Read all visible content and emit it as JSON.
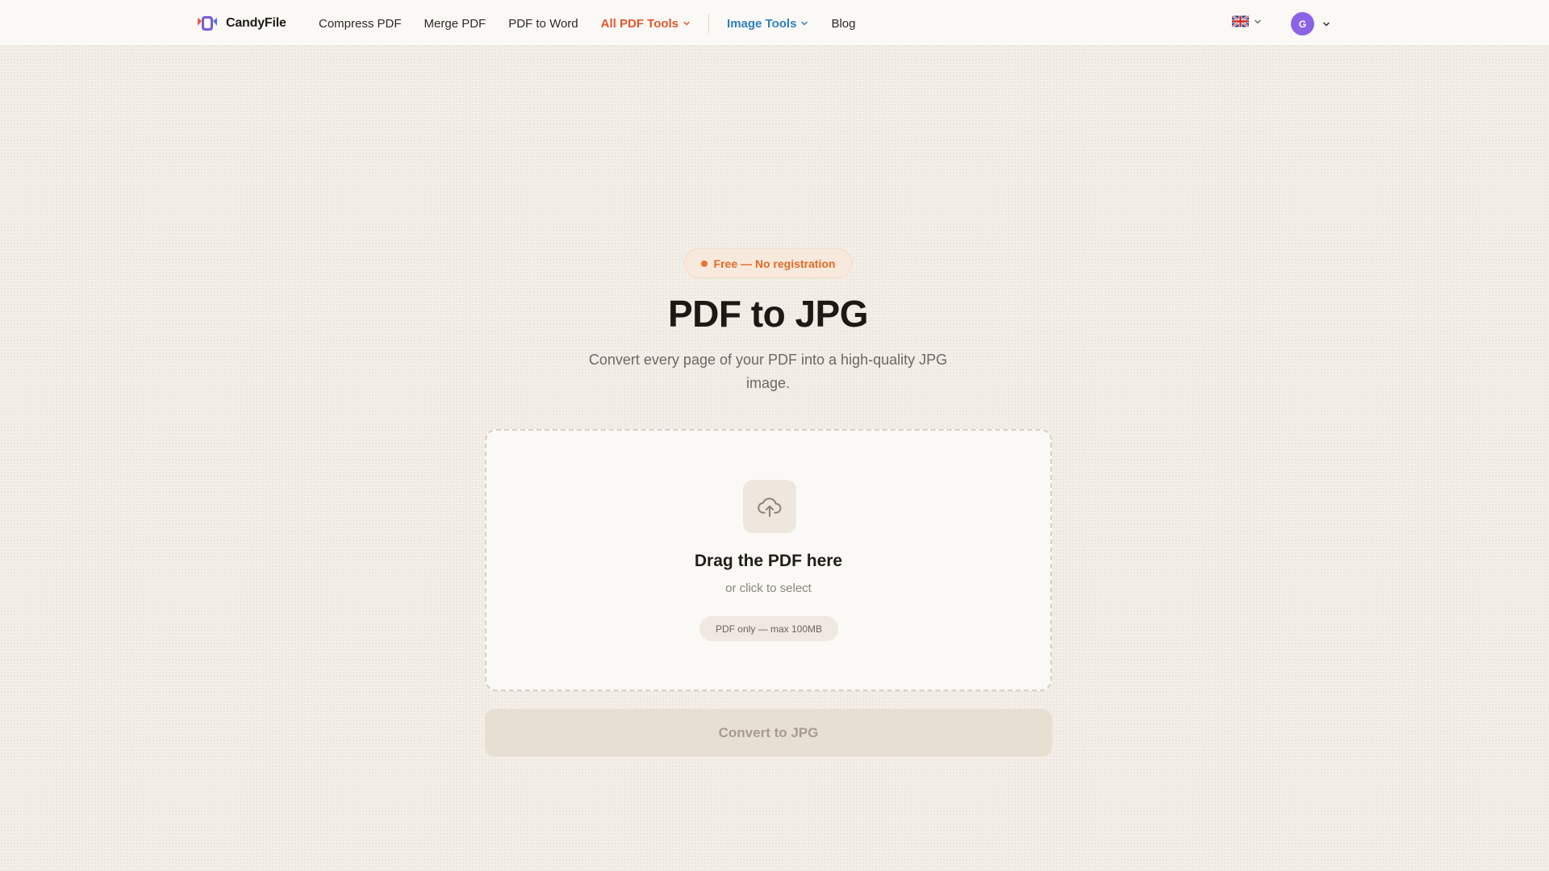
{
  "brand": {
    "name": "CandyFile",
    "logo_icon": "candy-logo-icon"
  },
  "nav": {
    "items": [
      {
        "label": "Compress PDF"
      },
      {
        "label": "Merge PDF"
      },
      {
        "label": "PDF to Word"
      },
      {
        "label": "All PDF Tools",
        "has_dropdown": true,
        "color": "#e0582b"
      },
      {
        "label": "Image Tools",
        "has_dropdown": true,
        "color": "#2f7fc1"
      },
      {
        "label": "Blog"
      }
    ]
  },
  "language": {
    "flag_icon": "uk-flag-icon",
    "has_dropdown": true
  },
  "user": {
    "initial": "G",
    "avatar_color": "#8c63e6",
    "has_dropdown": true
  },
  "hero": {
    "badge": "Free — No registration",
    "badge_color": "#e26a26",
    "title": "PDF to JPG",
    "subtitle": "Convert every page of your PDF into a high-quality JPG image."
  },
  "dropzone": {
    "icon": "cloud-upload-icon",
    "title": "Drag the PDF here",
    "subtitle": "or click to select",
    "limit": "PDF only — max 100MB"
  },
  "convert_button": {
    "label": "Convert to JPG",
    "state": "disabled"
  }
}
